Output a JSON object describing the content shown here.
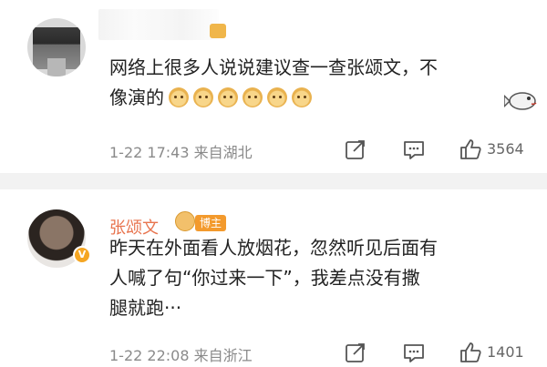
{
  "comments": [
    {
      "author": "",
      "text_line1": "网络上很多人说说建议查一查张颂文，不",
      "text_line2": "像演的",
      "meta": "1-22 17:43 来自湖北",
      "likes": "3564"
    },
    {
      "author": "张颂文",
      "host_tag": "博主",
      "verified_badge": "V",
      "text_line1": "昨天在外面看人放烟花，忽然听见后面有",
      "text_line2": "人喊了句“你过来一下”，我差点没有撒",
      "text_line3": "腿就跑···",
      "meta": "1-22 22:08 来自浙江",
      "likes": "1401"
    }
  ],
  "icons": {
    "share": "share-icon",
    "reply": "reply-icon",
    "like": "thumbs-up-icon",
    "emoji": "dog-emoji-icon",
    "sticker": "fish-sticker-icon"
  },
  "colors": {
    "author_name": "#e8744e",
    "host_tag": "#f39a2d",
    "meta_text": "#8a8a8a",
    "divider": "#f2f2f2"
  }
}
